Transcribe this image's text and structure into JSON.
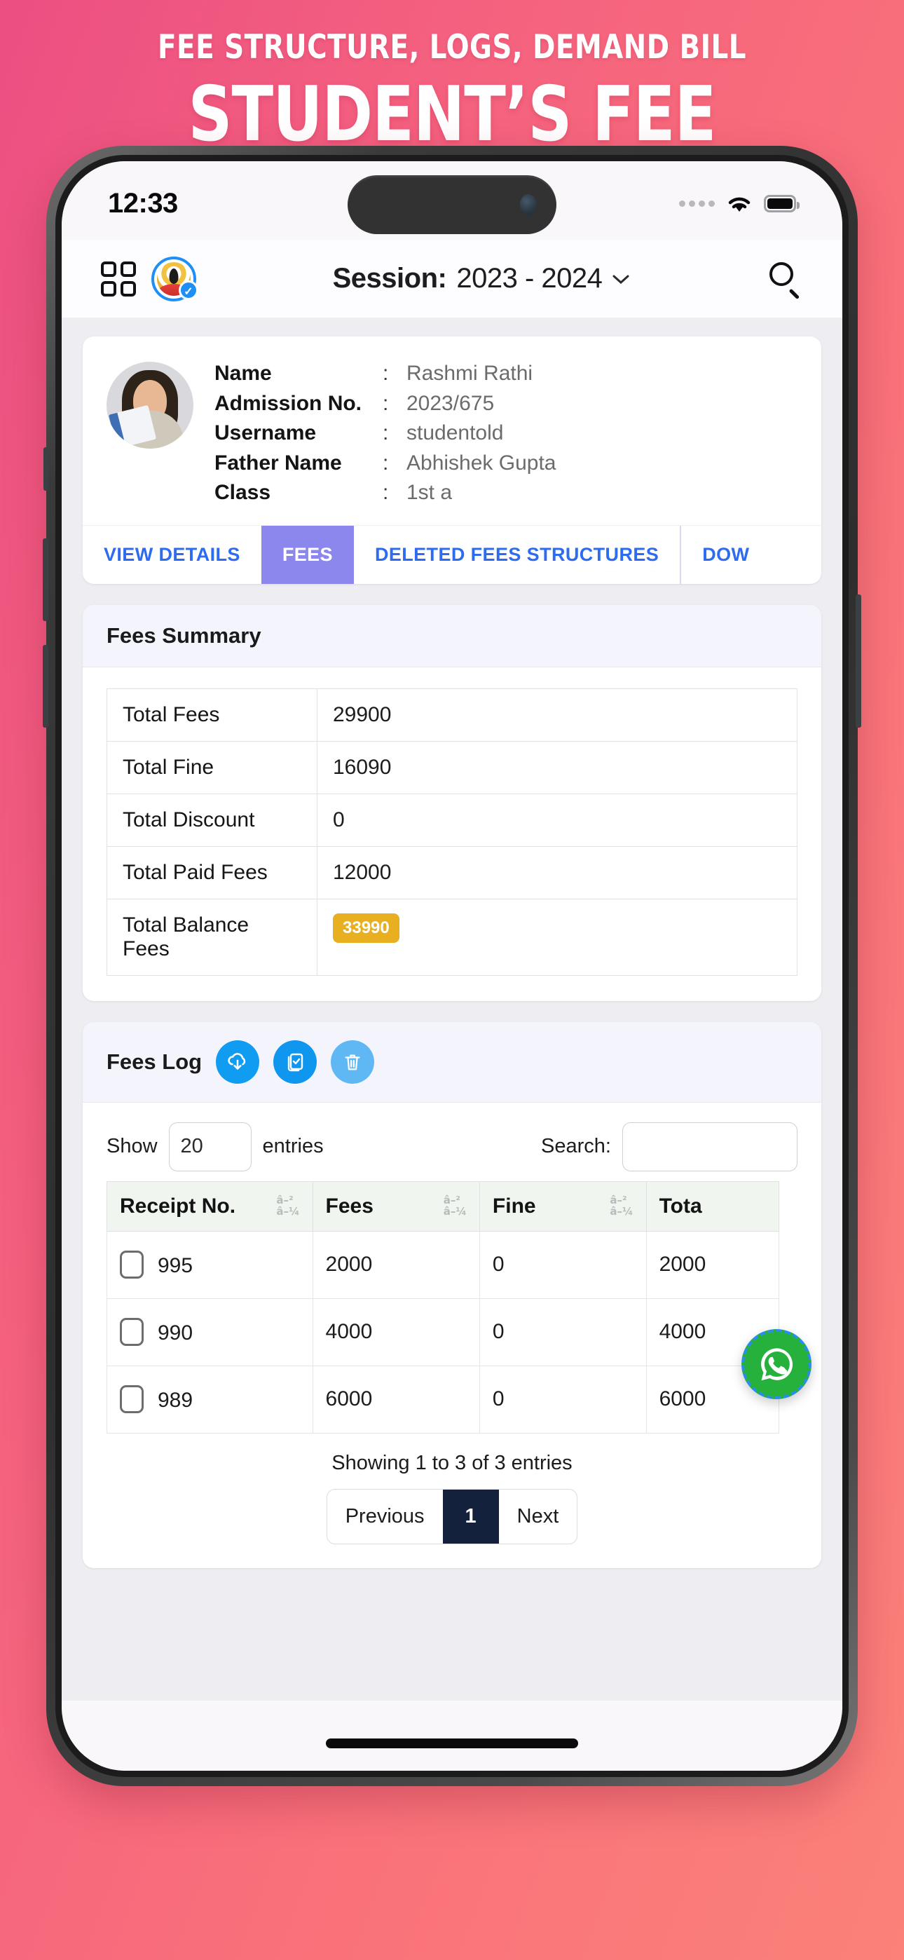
{
  "promo": {
    "subtitle": "FEE STRUCTURE, LOGS, DEMAND BILL",
    "title": "STUDENT’S FEE LEDGER"
  },
  "status_bar": {
    "time": "12:33",
    "wifi_icon": "wifi-icon",
    "battery_icon": "battery-icon",
    "signal_icon": "signal-dots-icon"
  },
  "app_bar": {
    "grid_icon": "grid-menu-icon",
    "logo_icon": "school-logo-icon",
    "verified_badge": "✓",
    "session_label": "Session:",
    "session_value": "2023 - 2024",
    "chevron": "⌄",
    "search_icon": "search-icon"
  },
  "student": {
    "avatar": "student-photo",
    "fields": [
      {
        "key": "Name",
        "sep": ":",
        "value": "Rashmi Rathi"
      },
      {
        "key": "Admission No.",
        "sep": ":",
        "value": "2023/675"
      },
      {
        "key": "Username",
        "sep": ":",
        "value": "studentold"
      },
      {
        "key": "Father Name",
        "sep": ":",
        "value": "Abhishek Gupta"
      },
      {
        "key": "Class",
        "sep": ":",
        "value": "1st a"
      }
    ]
  },
  "tabs": [
    {
      "label": "VIEW DETAILS",
      "active": false
    },
    {
      "label": "FEES",
      "active": true
    },
    {
      "label": "DELETED FEES STRUCTURES",
      "active": false
    },
    {
      "label": "DOW",
      "active": false
    }
  ],
  "fees_summary": {
    "title": "Fees Summary",
    "rows": [
      {
        "label": "Total Fees",
        "value": "29900",
        "badge": false
      },
      {
        "label": "Total Fine",
        "value": "16090",
        "badge": false
      },
      {
        "label": "Total Discount",
        "value": "0",
        "badge": false
      },
      {
        "label": "Total Paid Fees",
        "value": "12000",
        "badge": false
      },
      {
        "label": "Total Balance Fees",
        "value": "33990",
        "badge": true
      }
    ],
    "badge_color": "#e8b020"
  },
  "fees_log": {
    "title": "Fees Log",
    "actions": [
      {
        "name": "download-icon",
        "color": "#109cf1"
      },
      {
        "name": "select-all-icon",
        "color": "#0f97ef"
      },
      {
        "name": "delete-icon",
        "color": "#5fb7f4"
      }
    ],
    "show_label": "Show",
    "entries_label": "entries",
    "page_length": "20",
    "search_label": "Search:",
    "search_value": "",
    "search_placeholder": "",
    "sort_indicator": "â–²\nâ–¼",
    "sort_up": "â–²",
    "sort_down": "â–¼",
    "columns": [
      "Receipt No.",
      "Fees",
      "Fine",
      "Tota"
    ],
    "rows": [
      {
        "receipt": "995",
        "fees": "2000",
        "fine": "0",
        "total": "2000"
      },
      {
        "receipt": "990",
        "fees": "4000",
        "fine": "0",
        "total": "4000"
      },
      {
        "receipt": "989",
        "fees": "6000",
        "fine": "0",
        "total": "6000"
      }
    ],
    "showing": "Showing 1 to 3 of 3 entries",
    "pagination": {
      "previous": "Previous",
      "current": "1",
      "next": "Next"
    }
  },
  "fab": {
    "icon": "whatsapp-icon",
    "color": "#25b13c"
  },
  "colors": {
    "bg_start": "#ec4f82",
    "bg_end": "#fb8179",
    "tab_active": "#8b87ec",
    "link": "#2d6bf0",
    "pager_active": "#14213d"
  }
}
